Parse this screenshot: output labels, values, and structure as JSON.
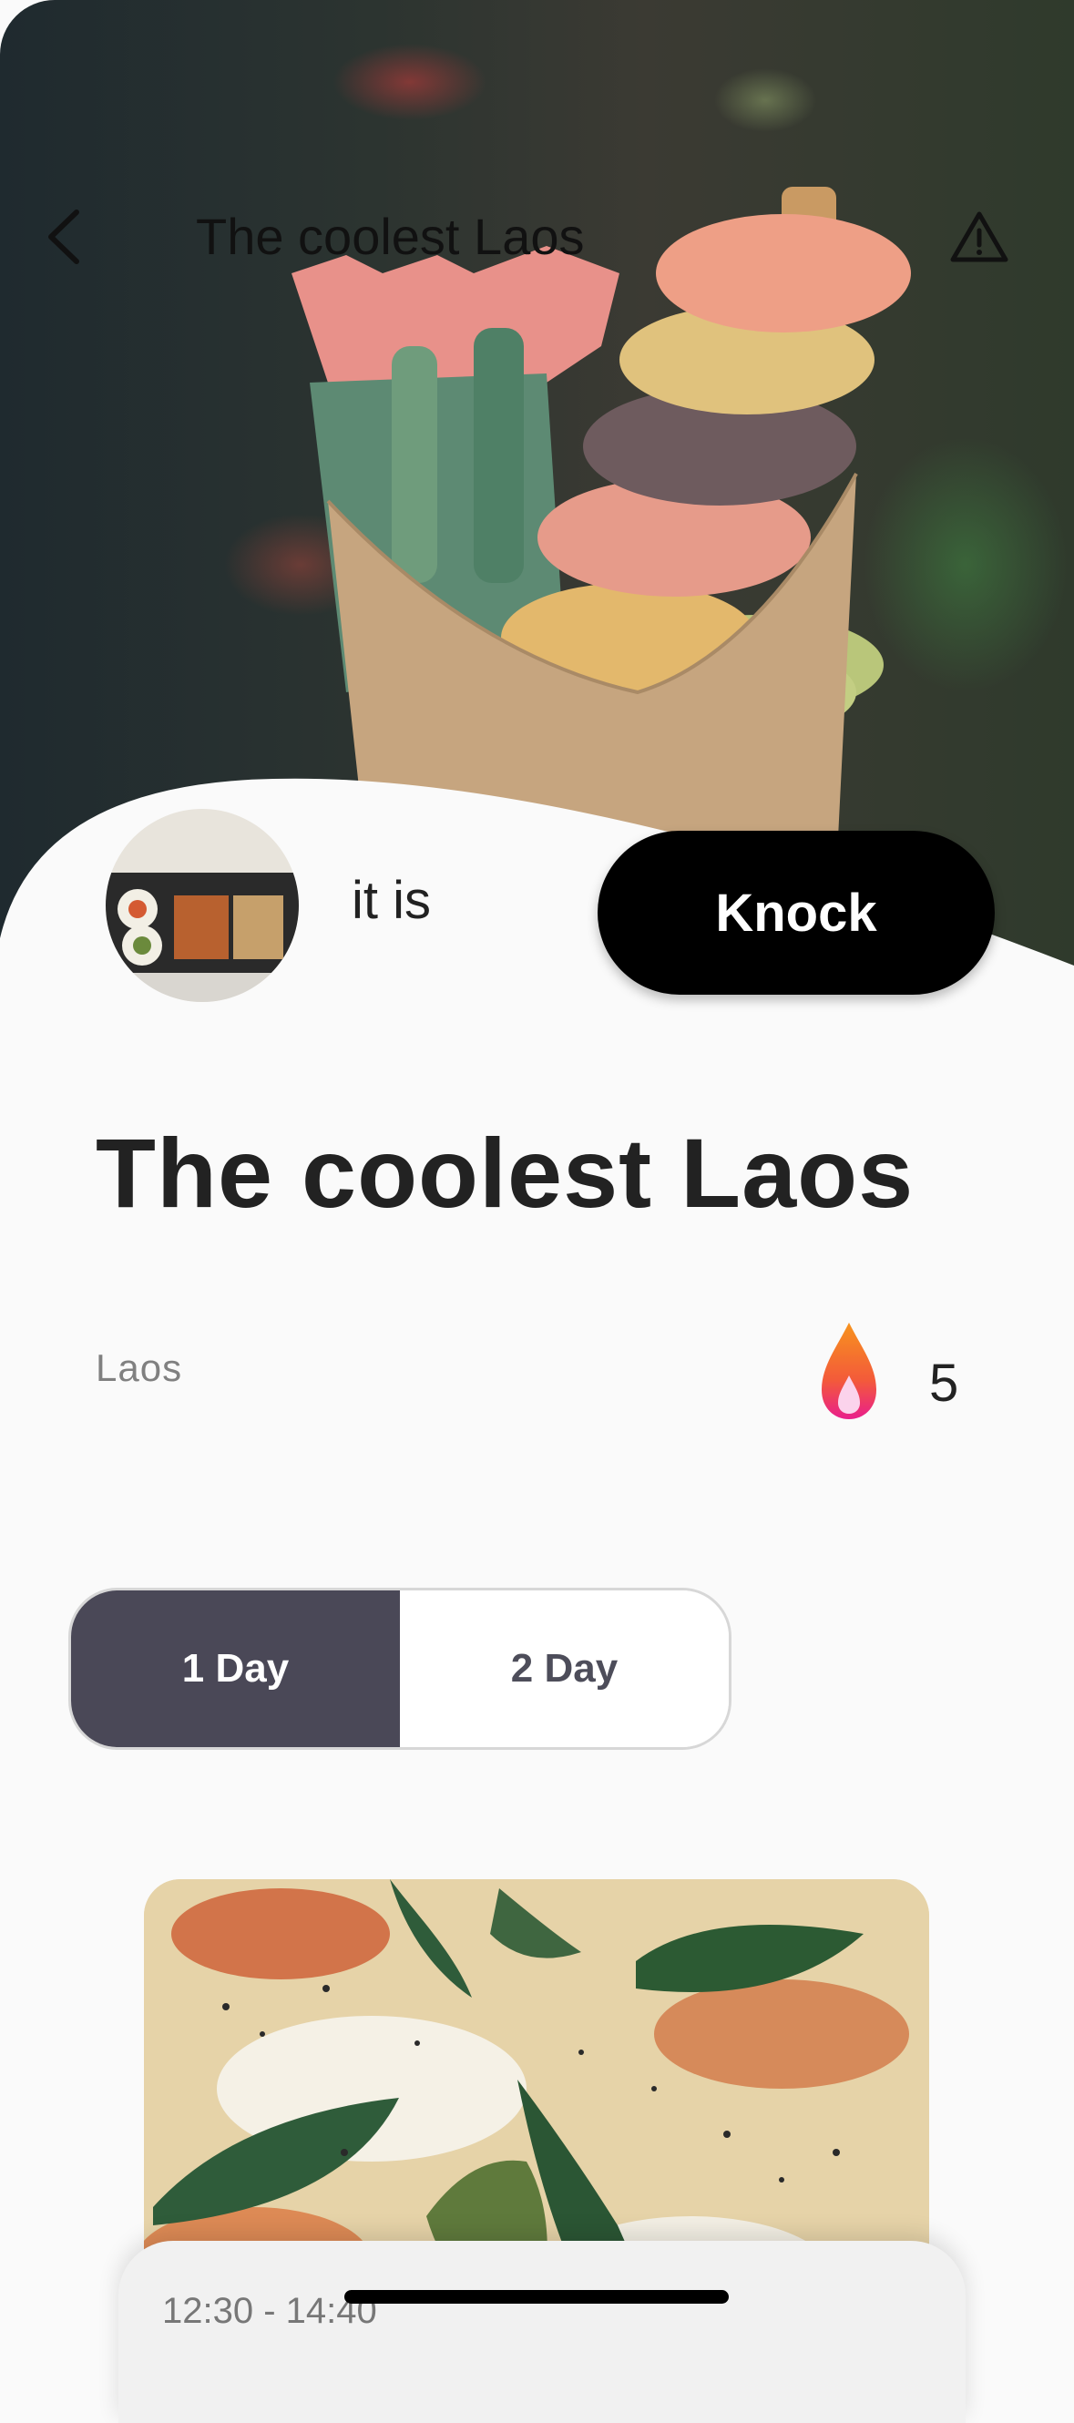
{
  "header": {
    "title": "The coolest Laos",
    "back_icon": "chevron-left-icon",
    "report_icon": "warning-triangle-icon"
  },
  "profile": {
    "name": "it is",
    "knock_label": "Knock"
  },
  "post": {
    "title": "The coolest Laos",
    "location": "Laos",
    "fire_count": "5"
  },
  "tabs": [
    {
      "label": "1 Day",
      "active": true
    },
    {
      "label": "2 Day",
      "active": false
    }
  ],
  "schedule": {
    "time": "12:30 - 14:40"
  },
  "colors": {
    "accent": "#000000",
    "tab_active": "#4a4857",
    "fire_orange": "#f7931e",
    "fire_pink": "#e91e8c"
  }
}
